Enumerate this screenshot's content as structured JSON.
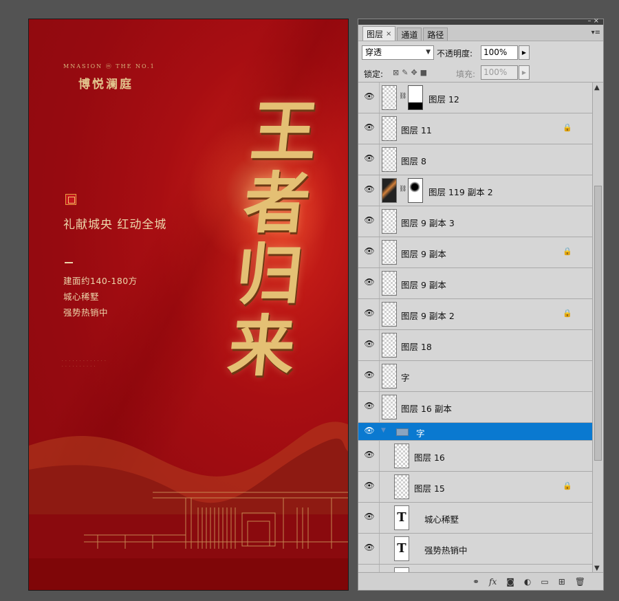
{
  "poster": {
    "mansion_text": "MNASION ⓜ THE NO.1",
    "brand_name": "博悦澜庭",
    "slogan": "礼献城央  红动全城",
    "info_lines": [
      "建面约140-180方",
      "城心稀墅",
      "强势热销中"
    ],
    "tiny_lines": [
      "· · · · · · · · · · · · ·",
      "· · · · · · · · · ·"
    ],
    "title_chars": [
      "王",
      "者",
      "归",
      "来"
    ],
    "colors": {
      "background": "#9a0c11",
      "gold": "#e4c074",
      "text_light": "#ecd6ab"
    }
  },
  "panel": {
    "tabs": [
      {
        "label": "图层",
        "active": true
      },
      {
        "label": "通道",
        "active": false
      },
      {
        "label": "路径",
        "active": false
      }
    ],
    "tab_close": "×",
    "menu_glyph": "▾≡",
    "blend_mode": "穿透",
    "opacity_label": "不透明度:",
    "opacity_value": "100%",
    "lock_label": "锁定:",
    "fill_label": "填充:",
    "fill_value": "100%",
    "layers": [
      {
        "name": "图层 12",
        "visible": true,
        "locked": false,
        "has_mask": true
      },
      {
        "name": "图层 11",
        "visible": true,
        "locked": true
      },
      {
        "name": "图层 8",
        "visible": true,
        "locked": false
      },
      {
        "name": "图层 119 副本 2",
        "visible": true,
        "locked": false,
        "has_mask": true
      },
      {
        "name": "图层 9 副本 3",
        "visible": true,
        "locked": false
      },
      {
        "name": "图层 9 副本",
        "visible": true,
        "locked": true
      },
      {
        "name": "图层 9 副本",
        "visible": true,
        "locked": false
      },
      {
        "name": "图层 9 副本 2",
        "visible": true,
        "locked": true
      },
      {
        "name": "图层 18",
        "visible": true,
        "locked": false
      },
      {
        "name": "字",
        "visible": true,
        "locked": false
      },
      {
        "name": "图层 16 副本",
        "visible": true,
        "locked": false
      },
      {
        "name": "字",
        "visible": true,
        "group": true,
        "selected": true
      },
      {
        "name": "图层 16",
        "visible": true,
        "locked": false,
        "indent": true
      },
      {
        "name": "图层 15",
        "visible": true,
        "locked": true,
        "indent": true
      },
      {
        "name": "城心稀墅",
        "visible": true,
        "type": "text",
        "indent": true
      },
      {
        "name": "强势热销中",
        "visible": true,
        "type": "text",
        "indent": true
      },
      {
        "name": "",
        "visible": false,
        "type": "text",
        "indent": true
      }
    ],
    "text_thumb_glyph": "T",
    "footer_icons": [
      "link-icon",
      "fx-icon",
      "mask-icon",
      "adjustment-icon",
      "new-group-icon",
      "new-layer-icon",
      "trash-icon"
    ],
    "footer_fx": "fx",
    "colors": {
      "panel_bg": "#d6d6d6",
      "selection": "#0a79d0"
    }
  }
}
